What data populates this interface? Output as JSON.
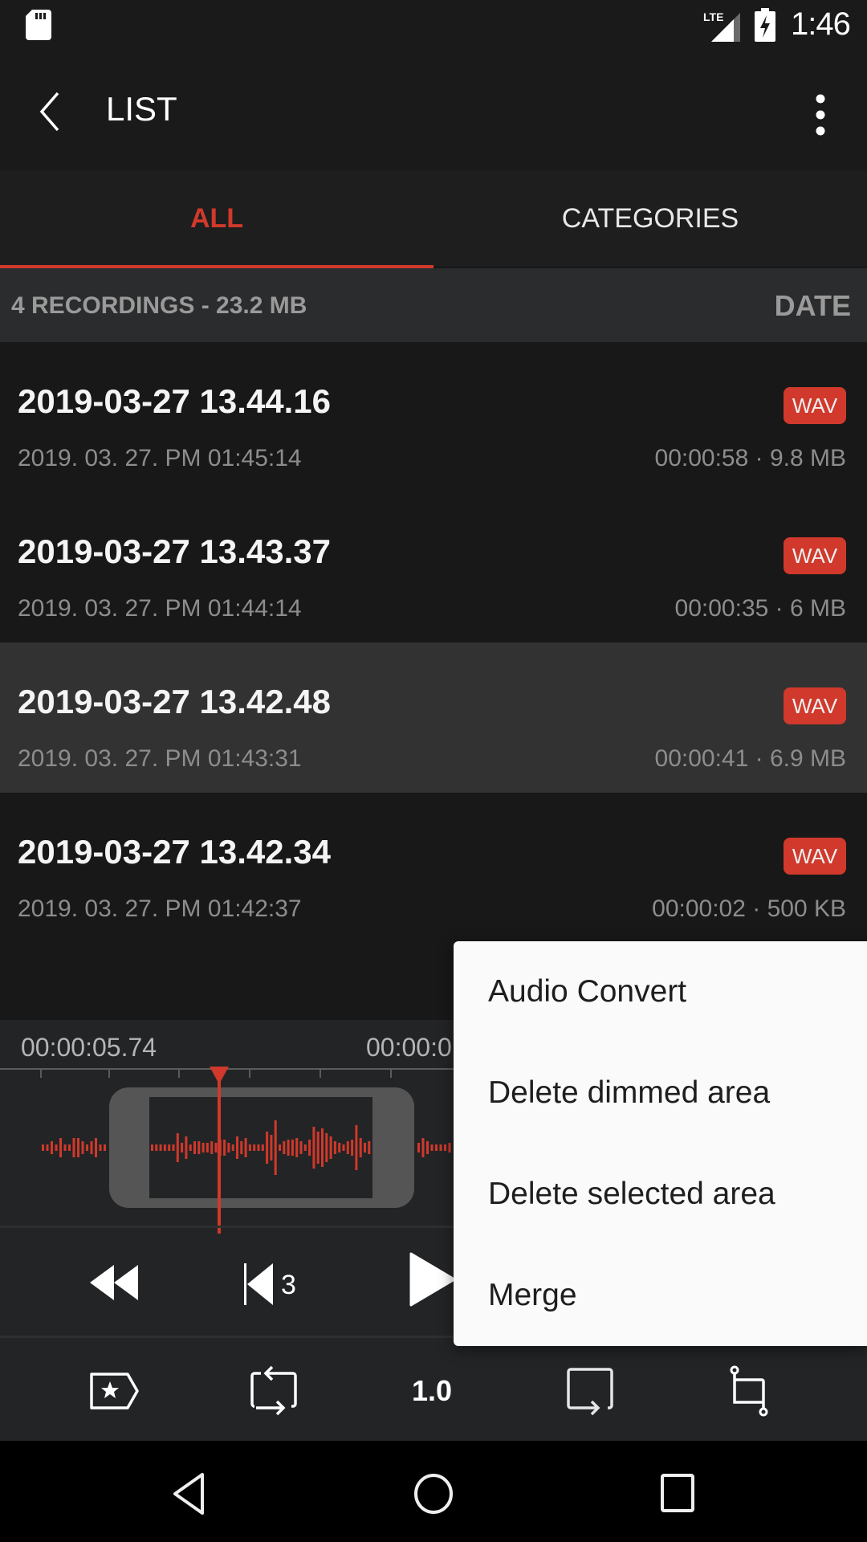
{
  "status_bar": {
    "time": "1:46",
    "network_label": "LTE",
    "icons": [
      "sd-card-icon",
      "lte-signal-icon",
      "battery-charging-icon"
    ]
  },
  "app_bar": {
    "title": "LIST",
    "back_icon": "chevron-left-icon",
    "more_icon": "more-vertical-icon"
  },
  "tabs": [
    {
      "label": "ALL",
      "active": true
    },
    {
      "label": "CATEGORIES",
      "active": false
    }
  ],
  "summary": {
    "text": "4 RECORDINGS - 23.2 MB",
    "sort_label": "DATE"
  },
  "recordings": [
    {
      "name": "2019-03-27 13.44.16",
      "date": "2019. 03. 27. PM 01:45:14",
      "meta": "00:00:58 · 9.8 MB",
      "format": "WAV",
      "selected": false
    },
    {
      "name": "2019-03-27 13.43.37",
      "date": "2019. 03. 27. PM 01:44:14",
      "meta": "00:00:35 · 6 MB",
      "format": "WAV",
      "selected": false
    },
    {
      "name": "2019-03-27 13.42.48",
      "date": "2019. 03. 27. PM 01:43:31",
      "meta": "00:00:41 · 6.9 MB",
      "format": "WAV",
      "selected": true
    },
    {
      "name": "2019-03-27 13.42.34",
      "date": "2019. 03. 27. PM 01:42:37",
      "meta": "00:00:02 · 500 KB",
      "format": "WAV",
      "selected": false
    }
  ],
  "player": {
    "time_left": "00:00:05.74",
    "time_right": "00:00:0",
    "skip_seconds": "3",
    "speed": "1.0"
  },
  "context_menu": {
    "items": [
      "Audio Convert",
      "Delete dimmed area",
      "Delete selected area",
      "Merge"
    ]
  },
  "colors": {
    "accent": "#d0392b",
    "background": "#181818",
    "selected_row": "#323232",
    "menu_bg": "#fafafa"
  }
}
